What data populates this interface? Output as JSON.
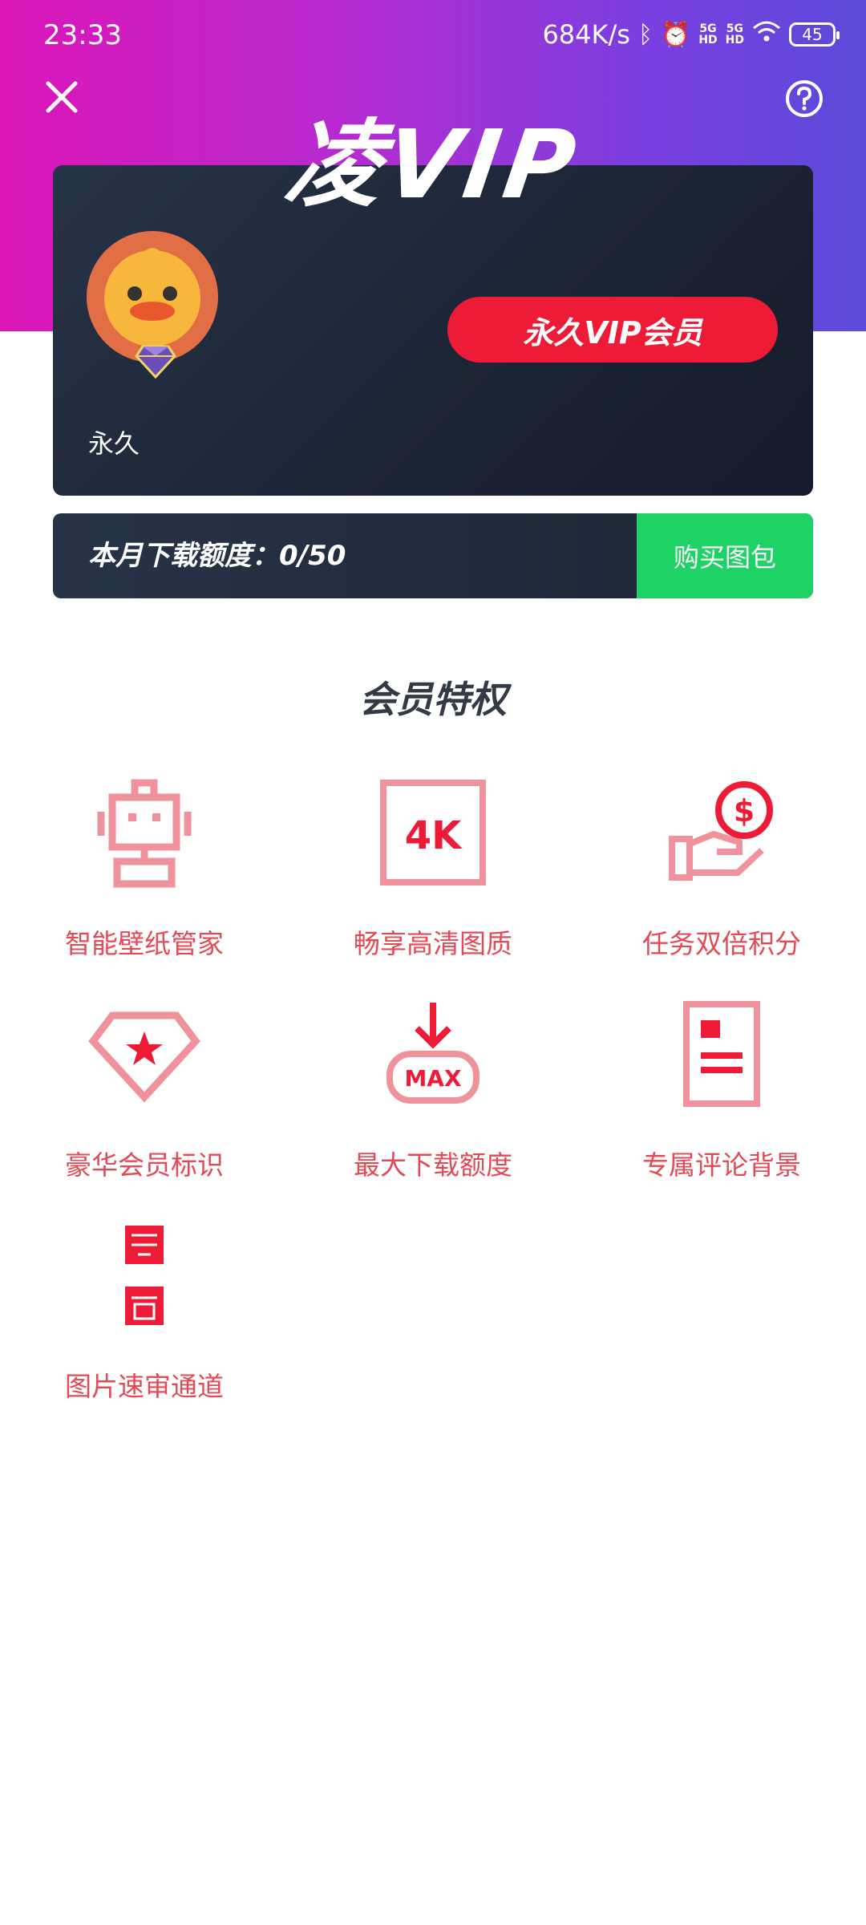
{
  "status_bar": {
    "time": "23:33",
    "net_speed": "684K/s",
    "battery": "45"
  },
  "header": {
    "title": "凌VIP",
    "close_icon": "close-icon",
    "help_icon": "help-icon"
  },
  "card": {
    "level_text": "永久",
    "vip_button": "永久VIP会员"
  },
  "quota": {
    "text": "本月下载额度：0/50",
    "buy_button": "购买图包"
  },
  "perks": {
    "title": "会员特权",
    "items": [
      {
        "label": "智能壁纸管家",
        "icon": "robot-icon"
      },
      {
        "label": "畅享高清图质",
        "icon": "4k-icon"
      },
      {
        "label": "任务双倍积分",
        "icon": "coin-hand-icon"
      },
      {
        "label": "豪华会员标识",
        "icon": "diamond-star-icon"
      },
      {
        "label": "最大下载额度",
        "icon": "max-download-icon"
      },
      {
        "label": "专属评论背景",
        "icon": "comment-card-icon"
      },
      {
        "label": "图片速审通道",
        "icon": "fast-review-icon"
      }
    ]
  },
  "colors": {
    "accent_red": "#ee1b36",
    "perk_pink": "#f0929b",
    "buy_green": "#1fd266",
    "card_dark": "#1c2536"
  }
}
